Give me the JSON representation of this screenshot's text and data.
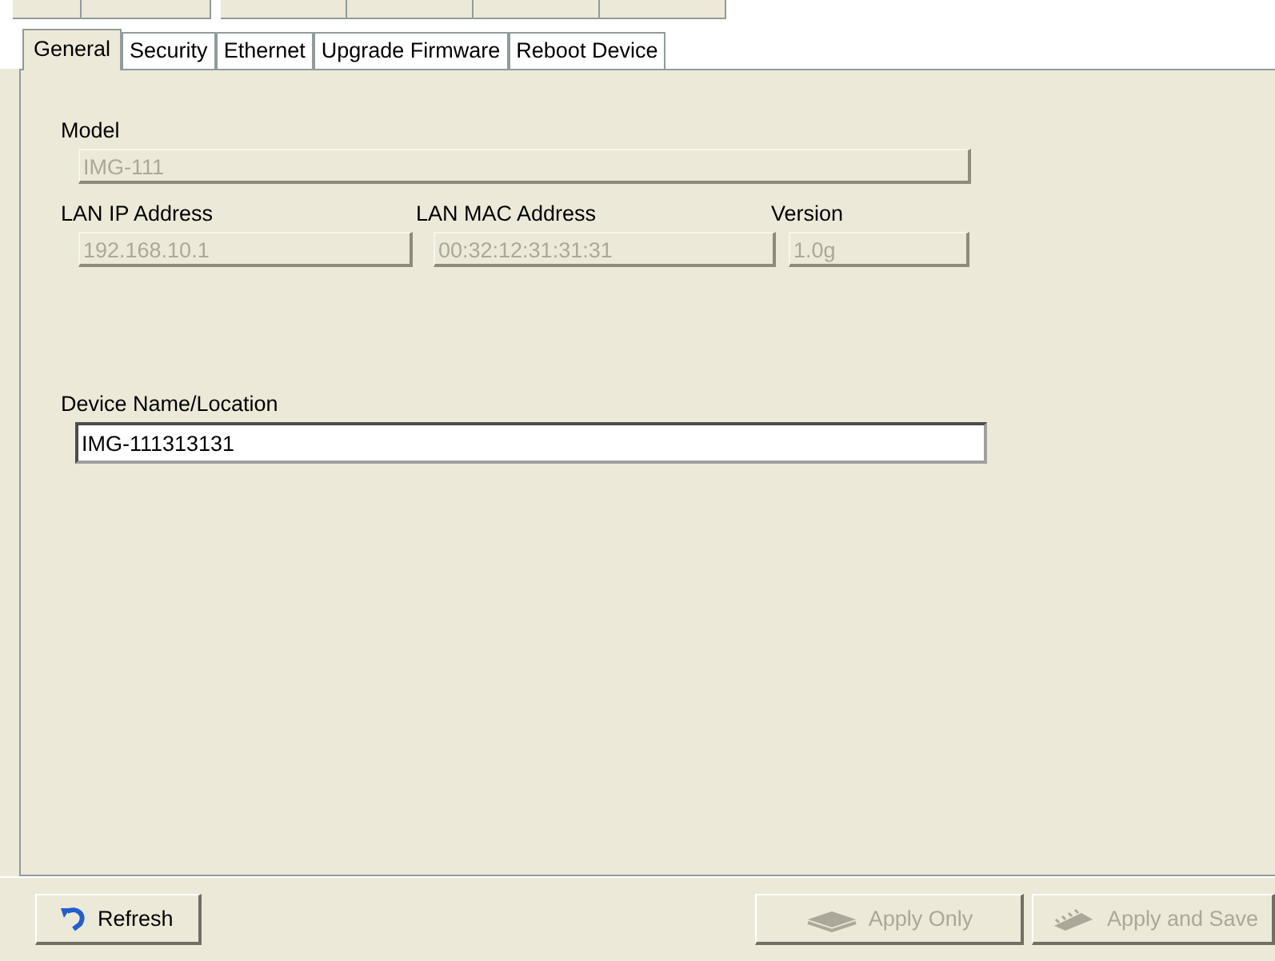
{
  "tabs": [
    {
      "label": "General",
      "selected": true
    },
    {
      "label": "Security",
      "selected": false
    },
    {
      "label": "Ethernet",
      "selected": false
    },
    {
      "label": "Upgrade Firmware",
      "selected": false
    },
    {
      "label": "Reboot Device",
      "selected": false
    }
  ],
  "fields": [
    {
      "label": "Model",
      "value": "IMG-111",
      "disabled": true
    },
    {
      "label": "LAN IP Address",
      "value": "192.168.10.1",
      "disabled": true
    },
    {
      "label": "LAN MAC Address",
      "value": "00:32:12:31:31:31",
      "disabled": true
    },
    {
      "label": "Version",
      "value": "1.0g",
      "disabled": true
    }
  ],
  "device_name": {
    "label": "Device Name/Location",
    "value": "IMG-111313131",
    "disabled": false
  },
  "buttons": [
    {
      "label": "Refresh",
      "kind": "refresh",
      "disabled": false
    },
    {
      "label": "Apply Only",
      "kind": "apply",
      "disabled": true
    },
    {
      "label": "Apply and Save",
      "kind": "save",
      "disabled": true
    }
  ]
}
